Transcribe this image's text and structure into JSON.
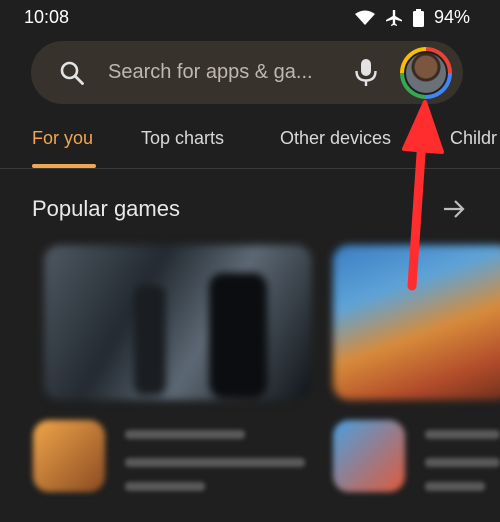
{
  "status_bar": {
    "time": "10:08",
    "battery": "94%",
    "icons": [
      "wifi-icon",
      "airplane-icon",
      "battery-icon"
    ]
  },
  "search": {
    "placeholder": "Search for apps & ga..."
  },
  "tabs": [
    {
      "label": "For you",
      "active": true
    },
    {
      "label": "Top charts",
      "active": false
    },
    {
      "label": "Other devices",
      "active": false
    },
    {
      "label": "Childr",
      "active": false
    }
  ],
  "section": {
    "title": "Popular games"
  },
  "colors": {
    "accent": "#f2a64f",
    "background": "#1f1f1f",
    "search_bg": "#37322c",
    "annotation_red": "#ff2d2d"
  }
}
